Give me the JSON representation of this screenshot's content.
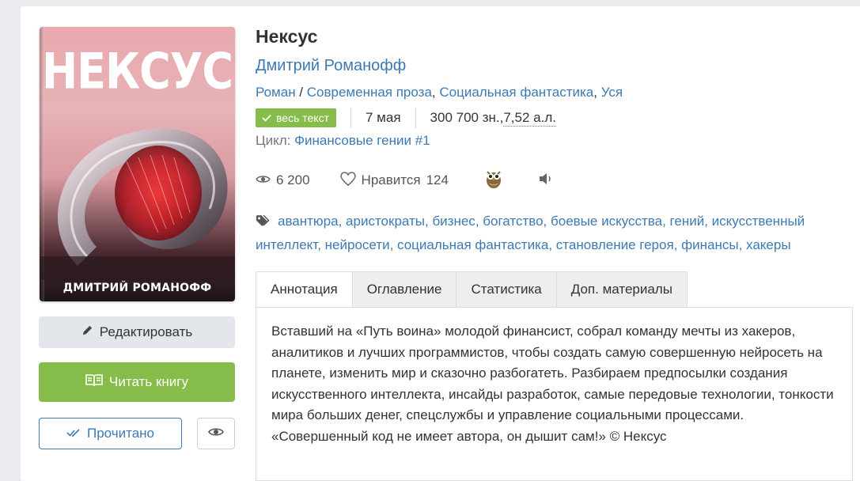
{
  "cover": {
    "title_text": "НЕКСУС",
    "author_text": "ДМИТРИЙ РОМАНОФФ"
  },
  "book": {
    "title": "Нексус",
    "author": "Дмитрий Романофф",
    "genres": [
      "Роман",
      "Современная проза",
      "Социальная фантастика",
      "Уся"
    ],
    "genre_sep_1": " / ",
    "genre_sep_2": ", ",
    "genre_sep_3": ", ",
    "status_badge": "весь текст",
    "date": "7 мая",
    "size_chars": "300 700 зн., ",
    "size_sheets": "7,52 а.л.",
    "cycle_label": "Цикл: ",
    "cycle_name": "Финансовые гении",
    "cycle_number": " #1"
  },
  "stats": {
    "views": "6 200",
    "likes_label": "Нравится",
    "likes": "124"
  },
  "tags": [
    "авантюра",
    "аристократы",
    "бизнес",
    "богатство",
    "боевые искусства",
    "гений",
    "искусственный интеллект",
    "нейросети",
    "социальная фантастика",
    "становление героя",
    "финансы",
    "хакеры"
  ],
  "tags_text": {
    "t0": "авантюра",
    "t1": "аристократы",
    "t2": "бизнес",
    "t3": "богатство",
    "t4": "боевые искусства",
    "t5": "гений",
    "t6": "искусственный интеллект",
    "t7": "нейросети",
    "t8": "социальная фантастика",
    "t9": "становление героя",
    "t10": "финансы",
    "t11": "хакеры"
  },
  "tabs": {
    "annotation": "Аннотация",
    "contents": "Оглавление",
    "statistics": "Статистика",
    "materials": "Доп. материалы",
    "active": "annotation"
  },
  "annotation": "Вставший на «Путь воина» молодой финансист, собрал команду мечты из хакеров, аналитиков и лучших программистов, чтобы создать самую совершенную нейросеть на планете, изменить мир и сказочно разбогатеть. Разбираем предпосылки создания искусственного интеллекта, инсайды разработок, самые передовые технологии, тонкости мира больших денег, спецслужбы и управление социальными процессами. «Совершенный код не имеет автора, он дышит сам!» © Нексус",
  "buttons": {
    "edit": "Редактировать",
    "read": "Читать книгу",
    "done": "Прочитано"
  },
  "icons": {
    "edit": "pencil-icon",
    "read": "open-book-icon",
    "done": "double-check-icon",
    "eye": "eye-icon",
    "views": "eye-icon",
    "likes": "heart-icon",
    "owl": "owl-icon",
    "audio": "speaker-icon",
    "tags": "tag-icon",
    "badge": "check-icon"
  },
  "colors": {
    "link": "#3d7ab3",
    "accent_green": "#86bd4a",
    "button_grey": "#e3e6ea"
  }
}
